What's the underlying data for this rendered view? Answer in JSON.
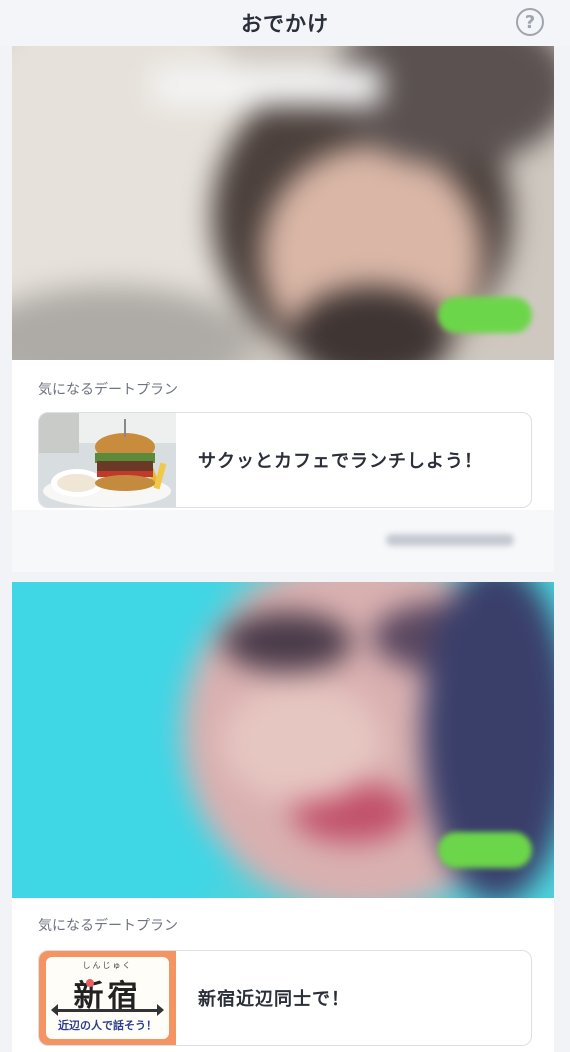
{
  "header": {
    "title": "おでかけ",
    "help_icon": "question-circle-icon"
  },
  "cards": [
    {
      "section_label": "気になるデートプラン",
      "plan_title": "サクッとカフェでランチしよう！",
      "thumb_icon": "burger-photo"
    },
    {
      "section_label": "気になるデートプラン",
      "plan_title": "新宿近辺同士で！",
      "thumb": {
        "ruby": "しんじゅく",
        "main": "新宿",
        "sub": "近辺の人で話そう！"
      }
    }
  ],
  "colors": {
    "accent_green": "#6cd64a",
    "shinjuku_frame": "#f39462",
    "background": "#f2f3f6"
  }
}
